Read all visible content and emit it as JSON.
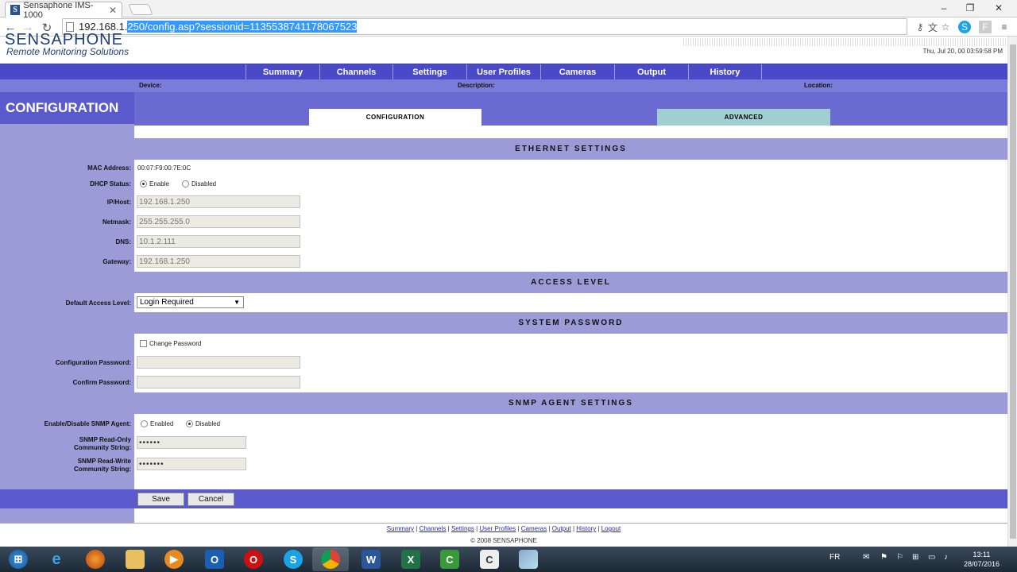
{
  "browser": {
    "tab_title": "Sensaphone IMS-1000",
    "favicon_letter": "S",
    "url_prefix": "192.168.1.",
    "url_selected": "250/config.asp?sessionid=1135538741178067523"
  },
  "header": {
    "logo_line1": "SENSAPHONE",
    "logo_line2": "Remote Monitoring Solutions",
    "datetime": "Thu, Jul 20, 00 03:59:58 PM"
  },
  "menu": [
    "Summary",
    "Channels",
    "Settings",
    "User Profiles",
    "Cameras",
    "Output",
    "History"
  ],
  "info": {
    "device": "Device:",
    "description": "Description:",
    "location": "Location:"
  },
  "page_title": "CONFIGURATION",
  "tabs": {
    "configuration": "CONFIGURATION",
    "advanced": "ADVANCED"
  },
  "ethernet": {
    "title": "ETHERNET SETTINGS",
    "mac_label": "MAC Address:",
    "mac_value": "00:07:F9:00:7E:0C",
    "dhcp_label": "DHCP Status:",
    "dhcp_enable": "Enable",
    "dhcp_disabled": "Disabled",
    "ip_label": "IP/Host:",
    "ip_value": "192.168.1.250",
    "netmask_label": "Netmask:",
    "netmask_value": "255.255.255.0",
    "dns_label": "DNS:",
    "dns_value": "10.1.2.111",
    "gateway_label": "Gateway:",
    "gateway_value": "192.168.1.250"
  },
  "access": {
    "title": "ACCESS LEVEL",
    "label": "Default Access Level:",
    "value": "Login Required"
  },
  "password": {
    "title": "SYSTEM PASSWORD",
    "change_label": "Change Password",
    "config_label": "Configuration Password:",
    "confirm_label": "Confirm Password:"
  },
  "snmp": {
    "title": "SNMP AGENT SETTINGS",
    "enable_label": "Enable/Disable SNMP Agent:",
    "enabled": "Enabled",
    "disabled": "Disabled",
    "ro_label_1": "SNMP Read-Only",
    "ro_label_2": "Community String:",
    "ro_value": "••••••",
    "rw_label_1": "SNMP Read-Write",
    "rw_label_2": "Community String:",
    "rw_value": "•••••••"
  },
  "buttons": {
    "save": "Save",
    "cancel": "Cancel"
  },
  "footer": {
    "links": [
      "Summary",
      "Channels",
      "Settings",
      "User Profiles",
      "Cameras",
      "Output",
      "History",
      "Logout"
    ],
    "separator": "|",
    "copyright": "© 2008 SENSAPHONE"
  },
  "taskbar": {
    "lang": "FR",
    "time": "13:11",
    "date": "28/07/2016"
  }
}
